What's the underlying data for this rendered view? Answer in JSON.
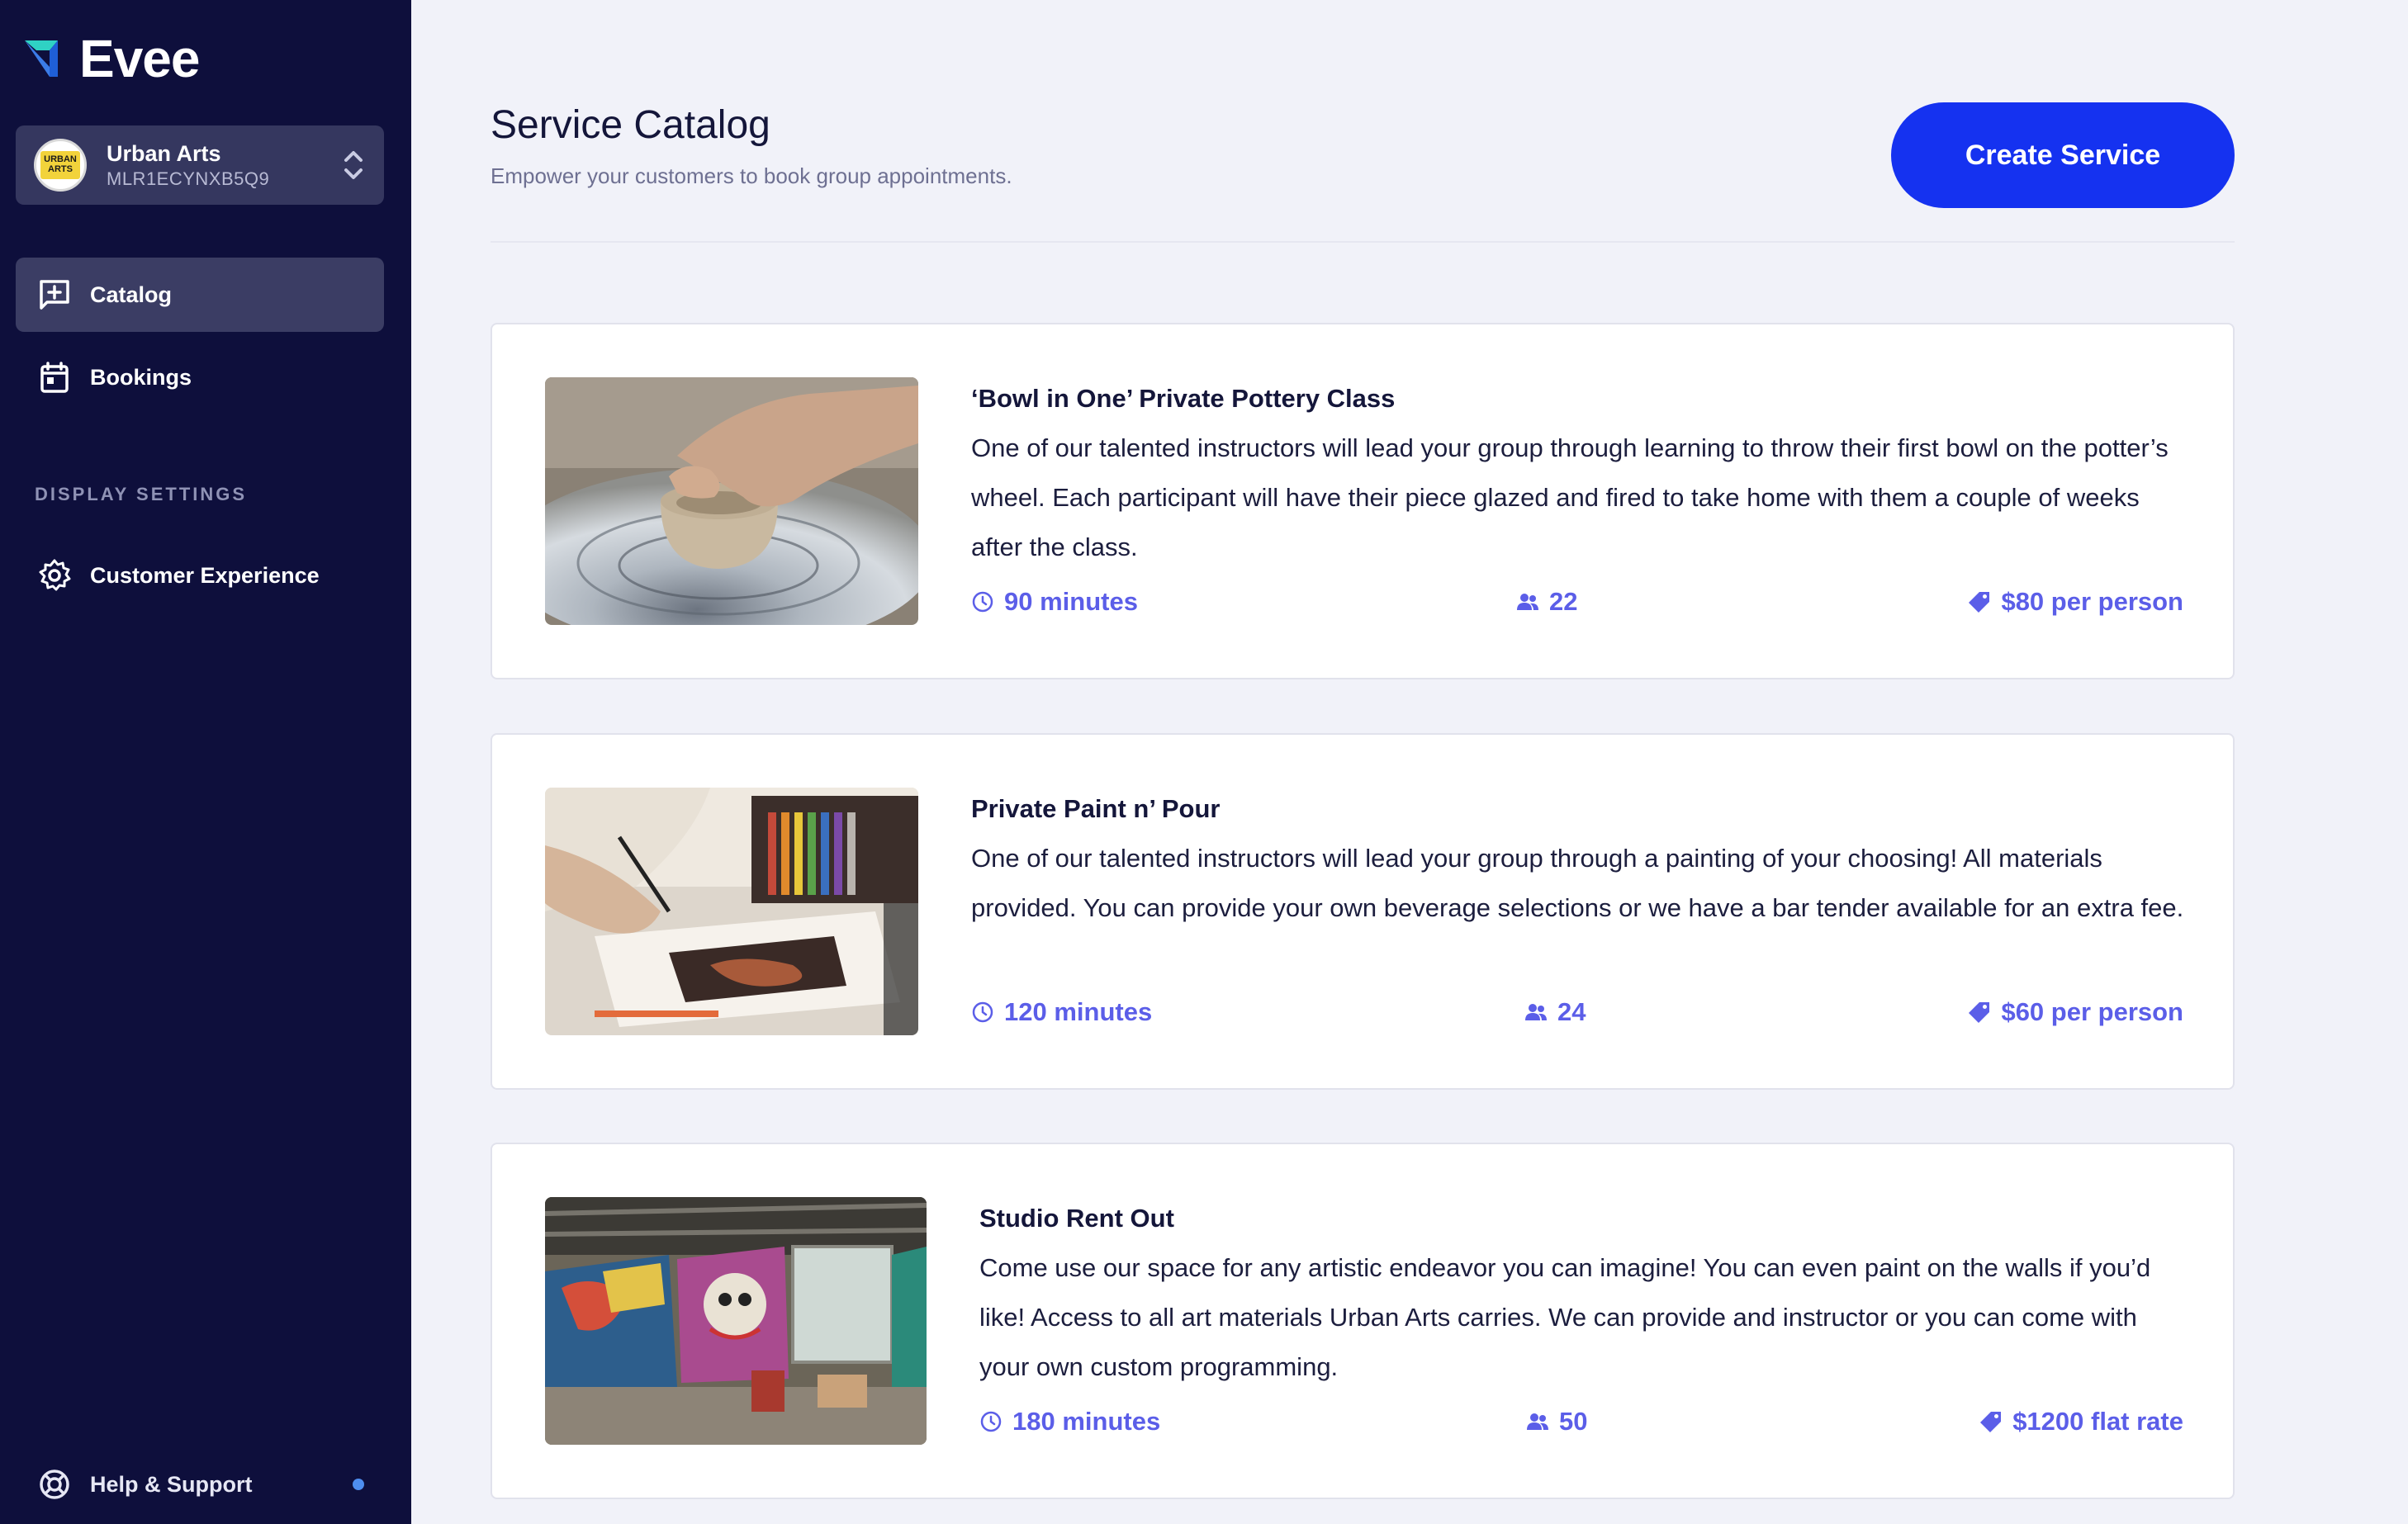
{
  "brand": {
    "name": "Evee"
  },
  "org": {
    "name": "Urban Arts",
    "id": "MLR1ECYNXB5Q9",
    "avatar_text": "URBAN ARTS"
  },
  "nav": {
    "catalog": "Catalog",
    "bookings": "Bookings",
    "section_label": "DISPLAY SETTINGS",
    "customer_experience": "Customer Experience",
    "help": "Help & Support"
  },
  "header": {
    "title": "Service Catalog",
    "subtitle": "Empower your customers to book group appointments.",
    "create_button": "Create Service"
  },
  "services": [
    {
      "title": "‘Bowl in One’ Private Pottery Class",
      "description": "One of our talented instructors will lead your group through learning to throw their first bowl on the potter’s wheel. Each participant will have their piece glazed and fired to take home with them a couple of weeks after the class.",
      "duration": "90 minutes",
      "capacity": "22",
      "price": "$80 per person",
      "image_icon": "pottery-photo"
    },
    {
      "title": "Private Paint n’ Pour",
      "description": "One of our talented instructors will lead your group through a painting of your choosing! All materials provided. You can provide your own beverage selections or we have a bar tender available for an extra fee.",
      "duration": "120 minutes",
      "capacity": "24",
      "price": "$60 per person",
      "image_icon": "painting-photo"
    },
    {
      "title": "Studio Rent Out",
      "description": "Come use our space for any artistic endeavor you can imagine! You can even paint on the walls if you’d like! Access to all art materials Urban Arts carries. We can provide and instructor or you can come with your own custom programming.",
      "duration": "180 minutes",
      "capacity": "50",
      "price": "$1200 flat rate",
      "image_icon": "studio-photo"
    }
  ],
  "colors": {
    "sidebar_bg": "#0e0f3c",
    "active_nav": "#3b3d64",
    "accent": "#1532f0",
    "meta": "#5b5ee8",
    "page_bg": "#f1f2f9"
  }
}
